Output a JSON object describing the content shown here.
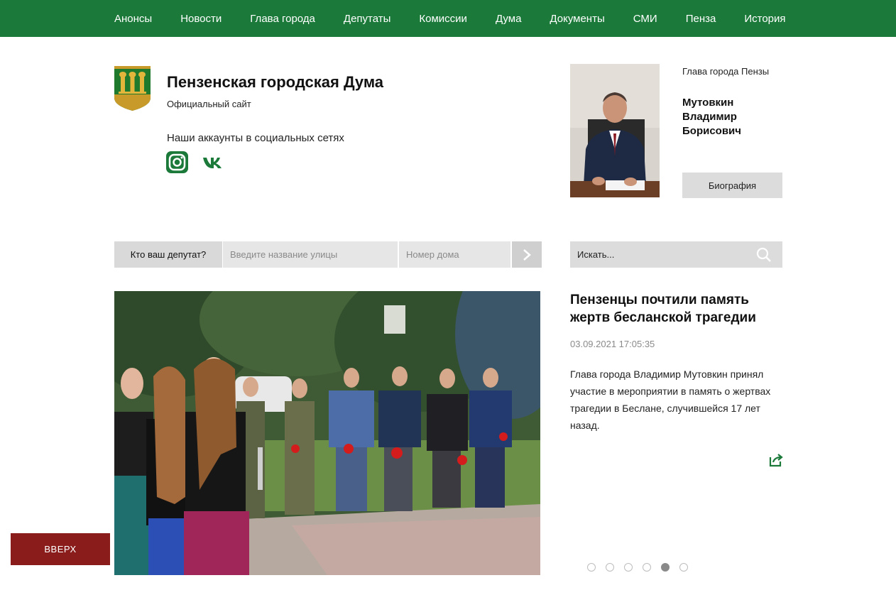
{
  "nav": {
    "items": [
      "Анонсы",
      "Новости",
      "Глава города",
      "Депутаты",
      "Комиссии",
      "Дума",
      "Документы",
      "СМИ",
      "Пенза",
      "История"
    ]
  },
  "header": {
    "title": "Пензенская городская Дума",
    "subtitle": "Официальный сайт",
    "social_title": "Наши аккаунты в социальных сетях",
    "social_icons": [
      "instagram-icon",
      "vk-icon"
    ]
  },
  "mayor": {
    "role": "Глава города Пензы",
    "name_line1": "Мутовкин",
    "name_line2": "Владимир",
    "name_line3": "Борисович",
    "bio_button": "Биография"
  },
  "finder": {
    "label": "Кто ваш депутат?",
    "street_placeholder": "Введите название улицы",
    "house_placeholder": "Номер дома"
  },
  "search": {
    "placeholder": "Искать..."
  },
  "news": {
    "title": "Пензенцы почтили память жертв бесланской трагедии",
    "date": "03.09.2021 17:05:35",
    "text": "Глава города Владимир Мутовкин принял участие в мероприятии в память о жертвах трагедии в Беслане, случившейся 17 лет назад.",
    "slide_count": 6,
    "active_slide": 5
  },
  "back_to_top": "ВВЕРХ",
  "colors": {
    "nav_green": "#1b7a3a",
    "top_button": "#8b1c1c",
    "gray_button": "#dcdcdc"
  }
}
